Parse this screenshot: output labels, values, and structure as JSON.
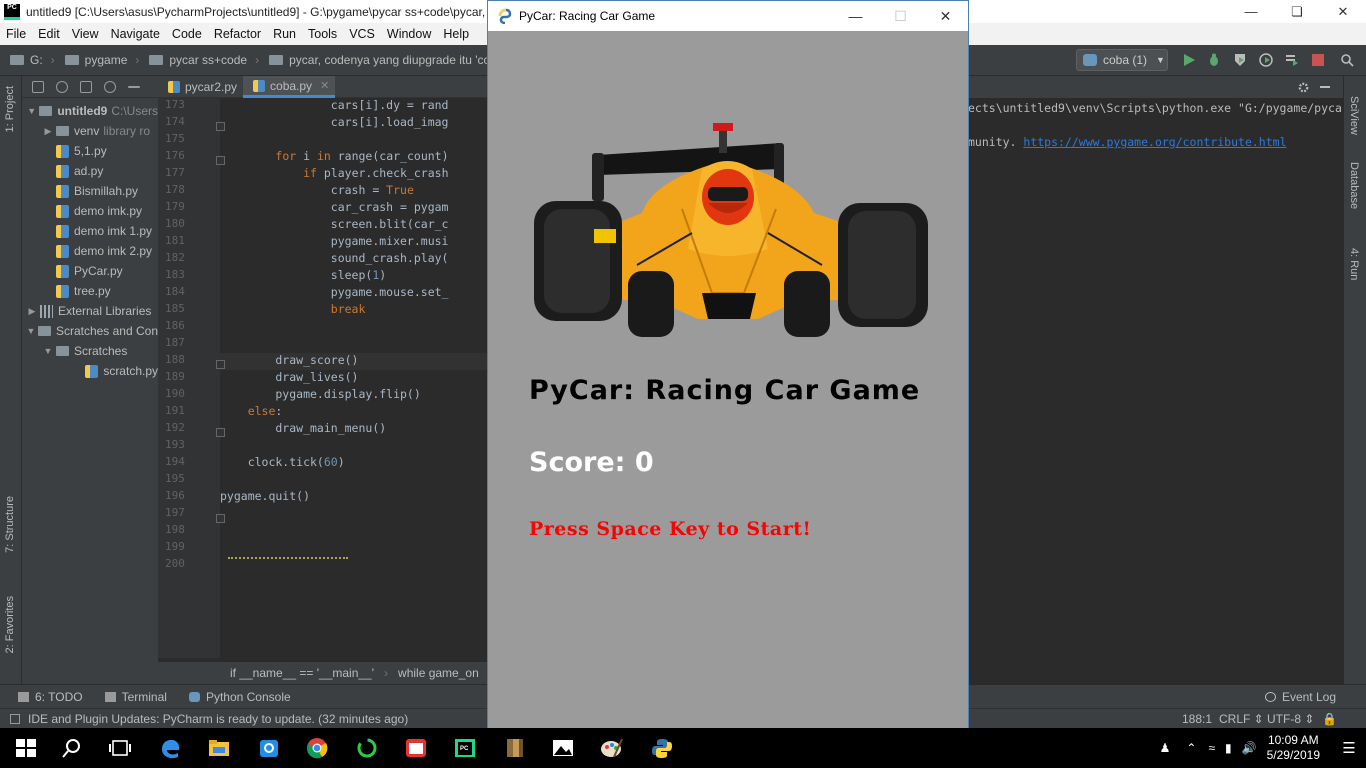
{
  "pycharm": {
    "title": "untitled9 [C:\\Users\\asus\\PycharmProjects\\untitled9] - G:\\pygame\\pycar ss+code\\pycar,",
    "menu": [
      "File",
      "Edit",
      "View",
      "Navigate",
      "Code",
      "Refactor",
      "Run",
      "Tools",
      "VCS",
      "Window",
      "Help"
    ],
    "breadcrumbs": [
      "G:",
      "pygame",
      "pycar ss+code",
      "pycar, codenya yang diupgrade itu 'coba'"
    ],
    "run_config": "coba (1)",
    "left_strip": [
      "1: Project",
      "7: Structure",
      "2: Favorites"
    ],
    "right_strip": [
      "SciView",
      "Database",
      "4: Run"
    ],
    "project_tree": [
      {
        "label": "untitled9",
        "extra": "C:\\Users",
        "type": "folder",
        "arrow": "▼",
        "indent": 0,
        "bold": true
      },
      {
        "label": "venv",
        "extra": "library ro",
        "type": "folder",
        "arrow": "▶",
        "indent": 1
      },
      {
        "label": "5,1.py",
        "type": "py",
        "indent": 1
      },
      {
        "label": "ad.py",
        "type": "py",
        "indent": 1
      },
      {
        "label": "Bismillah.py",
        "type": "py",
        "indent": 1
      },
      {
        "label": "demo imk.py",
        "type": "py",
        "indent": 1
      },
      {
        "label": "demo imk 1.py",
        "type": "py",
        "indent": 1
      },
      {
        "label": "demo imk 2.py",
        "type": "py",
        "indent": 1
      },
      {
        "label": "PyCar.py",
        "type": "py",
        "indent": 1
      },
      {
        "label": "tree.py",
        "type": "py",
        "indent": 1
      },
      {
        "label": "External Libraries",
        "type": "lib",
        "arrow": "▶",
        "indent": 0
      },
      {
        "label": "Scratches and Con",
        "type": "folder",
        "arrow": "▼",
        "indent": 0
      },
      {
        "label": "Scratches",
        "type": "folder",
        "arrow": "▼",
        "indent": 1
      },
      {
        "label": "scratch.py",
        "type": "py",
        "indent": 3
      }
    ],
    "tabs": [
      {
        "label": "pycar2.py",
        "active": false
      },
      {
        "label": "coba.py",
        "active": true
      }
    ],
    "line_numbers": [
      "173",
      "174",
      "175",
      "176",
      "177",
      "178",
      "179",
      "180",
      "181",
      "182",
      "183",
      "184",
      "185",
      "186",
      "187",
      "188",
      "189",
      "190",
      "191",
      "192",
      "193",
      "194",
      "195",
      "196",
      "197",
      "198",
      "199",
      "200"
    ],
    "code_lines": [
      "                cars[i].dy = rand",
      "                cars[i].load_imag",
      "",
      "        for i in range(car_count)",
      "            if player.check_crash",
      "                crash = True",
      "                car_crash = pygam",
      "                screen.blit(car_c",
      "                pygame.mixer.musi",
      "                sound_crash.play(",
      "                sleep(1)",
      "                pygame.mouse.set_",
      "                break",
      "",
      "",
      "        draw_score()",
      "        draw_lives()",
      "        pygame.display.flip()",
      "    else:",
      "        draw_main_menu()",
      "",
      "    clock.tick(60)",
      "",
      "pygame.quit()",
      "",
      "",
      ""
    ],
    "code_breadcrumb": [
      "if __name__ == '__main__'",
      "while game_on"
    ],
    "console_lines": [
      "ects\\untitled9\\venv\\Scripts\\python.exe \"G:/pygame/pyca",
      "munity. "
    ],
    "console_link": "https://www.pygame.org/contribute.html",
    "tool_windows": [
      "6: TODO",
      "Terminal",
      "Python Console"
    ],
    "event_log": "Event Log",
    "status_message": "IDE and Plugin Updates: PyCharm is ready to update. (32 minutes ago)",
    "status_position": "188:1",
    "status_line_sep": "CRLF",
    "status_encoding": "UTF-8"
  },
  "game": {
    "window_title": "PyCar: Racing Car Game",
    "title": "PyCar: Racing Car Game",
    "score_label": "Score: 0",
    "start_message": "Press Space Key to Start!",
    "background_color": "#9b9b9b",
    "message_color": "#ff0000"
  },
  "taskbar": {
    "time": "10:09 AM",
    "date": "5/29/2019"
  }
}
